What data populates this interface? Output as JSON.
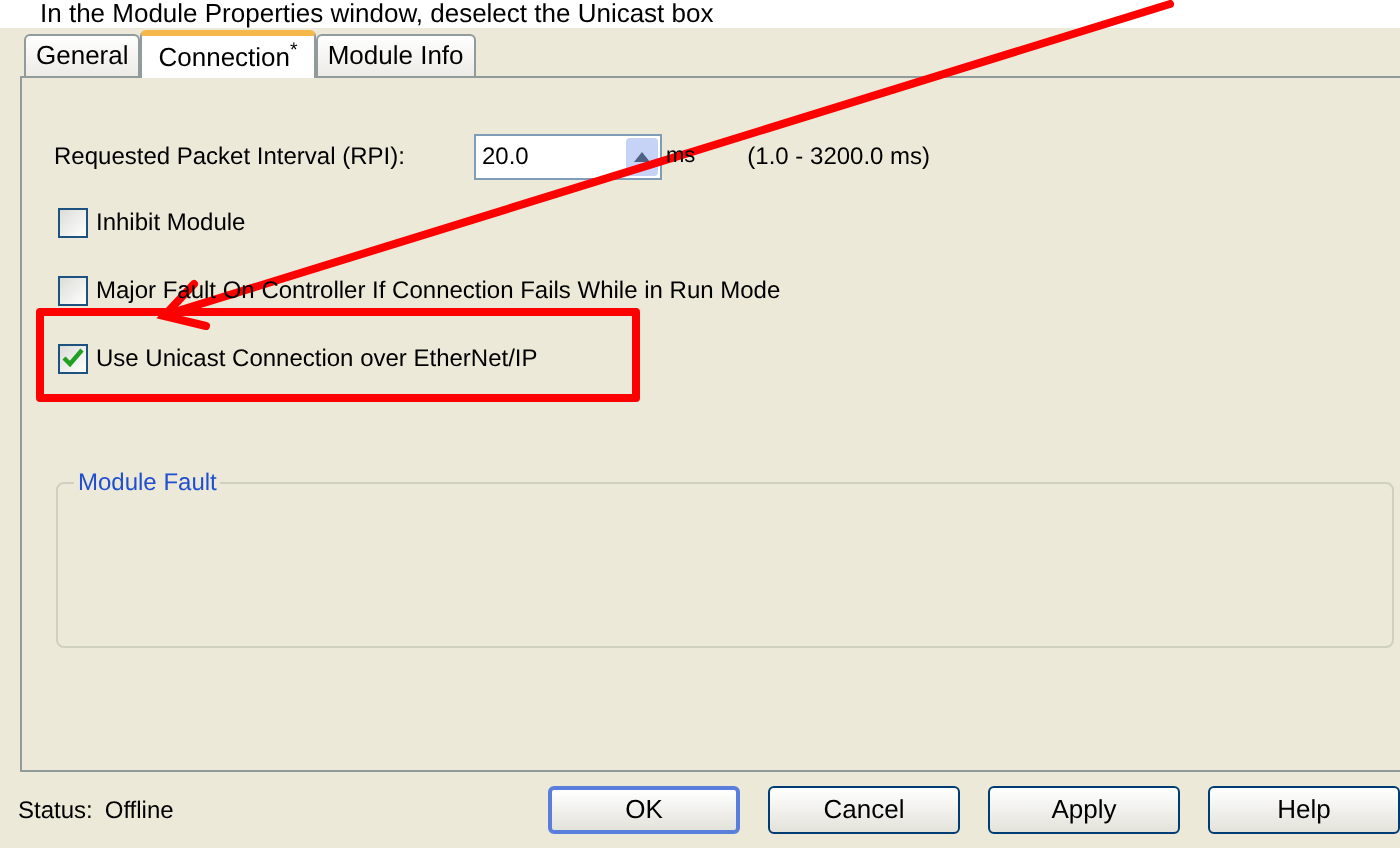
{
  "caption": "In the Module Properties window, deselect the Unicast box",
  "tabs": [
    {
      "label": "General",
      "selected": false
    },
    {
      "label": "Connection$^{*}$",
      "selected": true
    },
    {
      "label": "Module Info",
      "selected": false
    }
  ],
  "rpi": {
    "label": "Requested Packet Interval (RPI):",
    "value": "20.0",
    "unit": "ms",
    "range": "(1.0 - 3200.0 ms)"
  },
  "options": [
    {
      "label": "Inhibit Module",
      "checked": false
    },
    {
      "label": "Major Fault On Controller If Connection Fails While in Run Mode",
      "checked": false
    },
    {
      "label": "Use Unicast Connection over EtherNet/IP",
      "checked": true
    }
  ],
  "module_fault": {
    "title": "Module Fault"
  },
  "status": {
    "label": "Status:",
    "value": "Offline"
  },
  "buttons": [
    {
      "label": "OK",
      "default": true
    },
    {
      "label": "Cancel",
      "default": false
    },
    {
      "label": "Apply",
      "default": false
    },
    {
      "label": "Help",
      "default": false
    }
  ]
}
